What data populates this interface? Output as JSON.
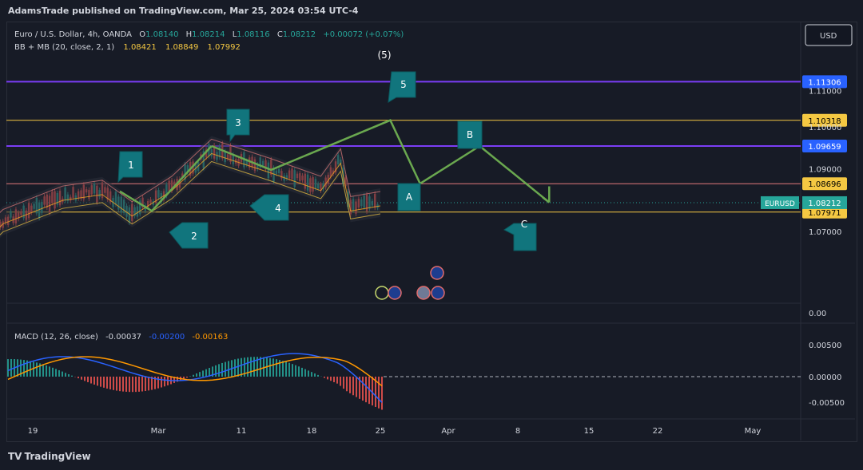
{
  "header": {
    "credit": "AdamsTrade published on TradingView.com, Mar 25, 2024 03:54 UTC-4"
  },
  "footer": {
    "logo_mark": "TV",
    "logo_text": "TradingView"
  },
  "currency_button": "USD",
  "colors": {
    "background": "#171b26",
    "wave_green": "#6aa84f",
    "label_teal": "#11757d",
    "level_purple": "#7b3df6",
    "level_yellow": "#f5c842",
    "level_pink": "#e47b7b",
    "candle_up": "#26a69a",
    "candle_down": "#ef5350",
    "macd_line": "#2962ff",
    "signal_line": "#ff9800"
  },
  "chart_data": {
    "type": "line",
    "symbol_line": {
      "name": "Euro / U.S. Dollar, 4h, OANDA",
      "o_label": "O",
      "o": "1.08140",
      "h_label": "H",
      "h": "1.08214",
      "l_label": "L",
      "l": "1.08116",
      "c_label": "C",
      "c": "1.08212",
      "change": "+0.00072 (+0.07%)"
    },
    "indicator_line": {
      "name": "BB + MB (20, close, 2, 1)",
      "v1": "1.08421",
      "v2": "1.08849",
      "v3": "1.07992"
    },
    "wave_degree_label": "(5)",
    "price_axis": {
      "ylim": [
        1.073,
        1.113
      ],
      "tick_labels": [
        {
          "value": 1.1108,
          "text": "1.11000"
        },
        {
          "value": 1.1015,
          "text": "1.10000"
        },
        {
          "value": 1.0908,
          "text": "1.09000"
        },
        {
          "value": 1.0748,
          "text": "1.07000"
        }
      ],
      "levels": [
        {
          "value": 1.11306,
          "text": "1.11306",
          "color": "#7b3df6",
          "label_bg": "#2962ff",
          "label_fg": "#ffffff"
        },
        {
          "value": 1.10318,
          "text": "1.10318",
          "color": "#f5c842",
          "label_bg": "#f5c842",
          "label_fg": "#000000"
        },
        {
          "value": 1.09659,
          "text": "1.09659",
          "color": "#7b3df6",
          "label_bg": "#2962ff",
          "label_fg": "#ffffff"
        },
        {
          "value": 1.08696,
          "text": "1.08696",
          "color": "#e47b7b",
          "label_bg": "#f5c842",
          "label_fg": "#000000"
        },
        {
          "value": 1.07971,
          "text": "1.07971",
          "color": "#f5c842",
          "label_bg": "#f5c842",
          "label_fg": "#000000"
        }
      ],
      "last_price": {
        "value": 1.08212,
        "text": "1.08212",
        "symbol_tag": "EURUSD"
      }
    },
    "time_axis": {
      "tick_labels": [
        "19",
        "Mar",
        "11",
        "18",
        "25",
        "Apr",
        "8",
        "15",
        "22",
        "May"
      ]
    },
    "price_series": [
      {
        "date": "2024-02-13",
        "close": 1.07
      },
      {
        "date": "2024-02-16",
        "close": 1.0775
      },
      {
        "date": "2024-02-22",
        "close": 1.0835
      },
      {
        "date": "2024-02-26",
        "close": 1.085
      },
      {
        "date": "2024-02-29",
        "close": 1.0795
      },
      {
        "date": "2024-03-04",
        "close": 1.086
      },
      {
        "date": "2024-03-08",
        "close": 1.0955
      },
      {
        "date": "2024-03-11",
        "close": 1.093
      },
      {
        "date": "2024-03-14",
        "close": 1.0905
      },
      {
        "date": "2024-03-19",
        "close": 1.086
      },
      {
        "date": "2024-03-21",
        "close": 1.093
      },
      {
        "date": "2024-03-22",
        "close": 1.0808
      },
      {
        "date": "2024-03-25",
        "close": 1.0821
      }
    ],
    "elliott_path": [
      {
        "label": "3",
        "date": "2024-03-08",
        "price": 1.0966
      },
      {
        "label": "4",
        "date": "2024-03-14",
        "price": 1.0905
      },
      {
        "label": "5",
        "date": "2024-03-26",
        "price": 1.1032
      },
      {
        "label": "A",
        "date": "2024-03-29",
        "price": 1.087
      },
      {
        "label": "B",
        "date": "2024-04-04",
        "price": 1.0966
      },
      {
        "label": "C",
        "date": "2024-04-11",
        "price": 1.0822
      }
    ],
    "wave_labels": [
      "1",
      "2",
      "3",
      "4",
      "5",
      "A",
      "B",
      "C"
    ],
    "secondary_axis_label": "0.00",
    "macd": {
      "name": "MACD (12, 26, close)",
      "values": [
        "-0.00037",
        "-0.00200",
        "-0.00163"
      ],
      "ylim": [
        -0.0025,
        0.0032
      ],
      "tick_labels": [
        {
          "value": 0.0025,
          "text": "0.00500"
        },
        {
          "value": 0.0,
          "text": "0.00000"
        },
        {
          "value": -0.002,
          "text": "-0.00500"
        }
      ],
      "series": [
        {
          "name": "MACD",
          "color": "#2962ff"
        },
        {
          "name": "Signal",
          "color": "#ff9800"
        }
      ]
    }
  }
}
